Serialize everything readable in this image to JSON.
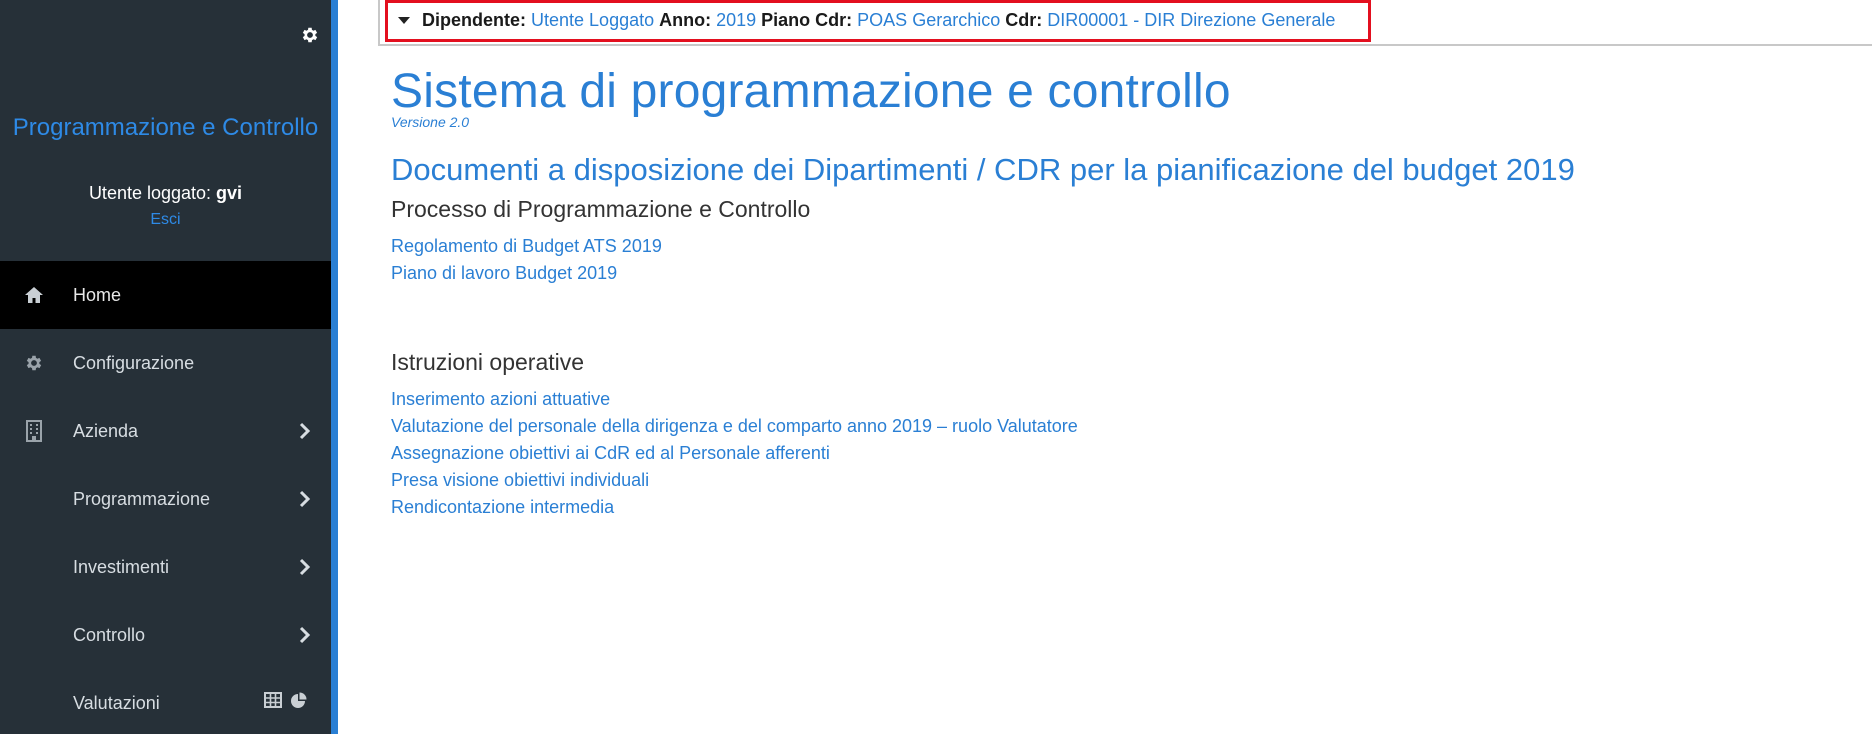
{
  "sidebar": {
    "settings_icon": "gear-icon",
    "app_title": "Programmazione e Controllo",
    "user_label": "Utente loggato:",
    "user_name": "gvi",
    "logout_label": "Esci",
    "items": [
      {
        "label": "Home",
        "icon": "home-icon",
        "active": true
      },
      {
        "label": "Configurazione",
        "icon": "gear-icon"
      },
      {
        "label": "Azienda",
        "icon": "building-icon",
        "chevron": true
      },
      {
        "label": "Programmazione",
        "chevron": true
      },
      {
        "label": "Investimenti",
        "chevron": true
      },
      {
        "label": "Controllo",
        "chevron": true
      },
      {
        "label": "Valutazioni",
        "extra_icons": [
          "table-icon",
          "pie-chart-icon"
        ]
      }
    ]
  },
  "context": {
    "dipendente_key": "Dipendente:",
    "dipendente_val": "Utente Loggato",
    "anno_key": "Anno:",
    "anno_val": "2019",
    "piano_key": "Piano Cdr:",
    "piano_val": "POAS Gerarchico",
    "cdr_key": "Cdr:",
    "cdr_val": "DIR00001 - DIR Direzione Generale"
  },
  "main": {
    "title": "Sistema di programmazione e controllo",
    "version": "Versione 2.0",
    "section_title": "Documenti a disposizione dei Dipartimenti / CDR per la pianificazione del budget 2019",
    "process_title": "Processo di Programmazione e Controllo",
    "process_links": [
      "Regolamento di Budget ATS 2019",
      "Piano di lavoro Budget 2019"
    ],
    "instructions_title": "Istruzioni operative",
    "instruction_links": [
      "Inserimento azioni attuative",
      "Valutazione del personale della dirigenza e del comparto anno 2019 – ruolo Valutatore",
      "Assegnazione obiettivi ai CdR ed al Personale afferenti",
      "Presa visione obiettivi individuali",
      "Rendicontazione intermedia"
    ]
  },
  "colors": {
    "sidebar_bg": "#263038",
    "accent": "#2a7fd4",
    "highlight_border": "#e30f1f"
  }
}
